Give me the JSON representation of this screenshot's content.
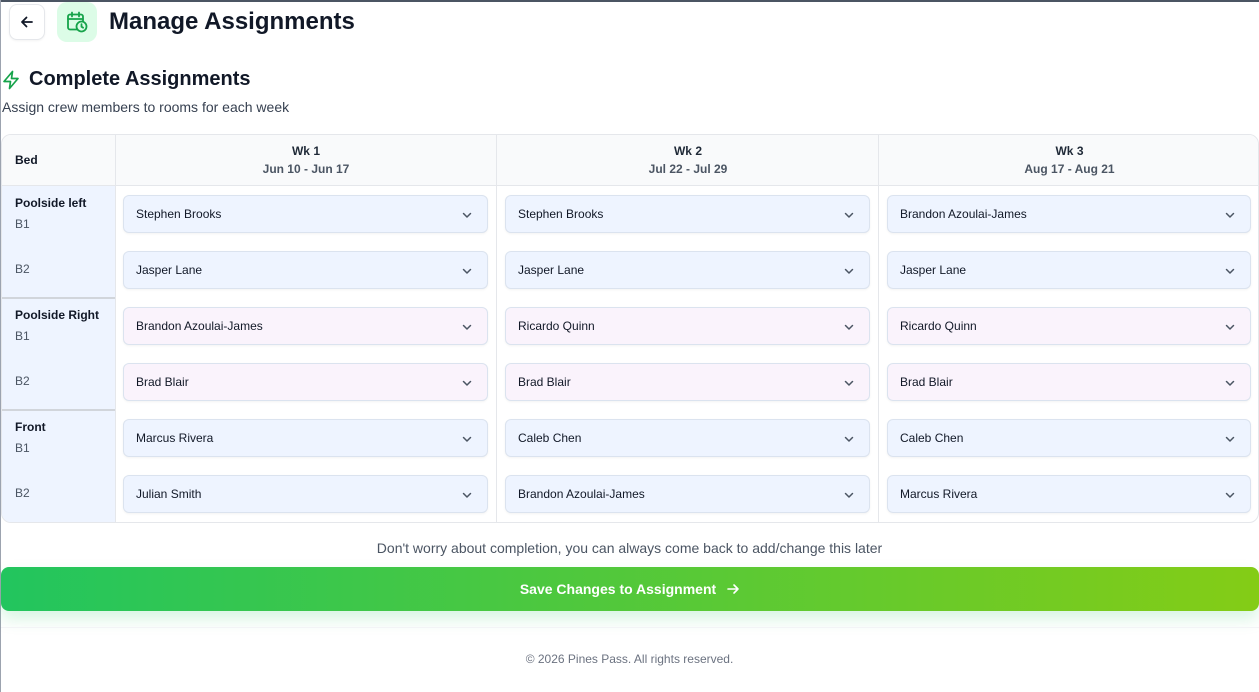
{
  "header": {
    "title": "Manage Assignments"
  },
  "section": {
    "title": "Complete Assignments",
    "subtitle": "Assign crew members to rooms for each week"
  },
  "table": {
    "bed_header": "Bed",
    "weeks": [
      {
        "label": "Wk 1",
        "dates": "Jun 10 - Jun 17"
      },
      {
        "label": "Wk 2",
        "dates": "Jul 22 - Jul 29"
      },
      {
        "label": "Wk 3",
        "dates": "Aug 17 - Aug 21"
      }
    ],
    "rooms": [
      {
        "name": "Poolside left",
        "tint": "blue",
        "beds": [
          {
            "code": "B1",
            "assignments": [
              "Stephen Brooks",
              "Stephen Brooks",
              "Brandon Azoulai-James"
            ]
          },
          {
            "code": "B2",
            "assignments": [
              "Jasper Lane",
              "Jasper Lane",
              "Jasper Lane"
            ]
          }
        ]
      },
      {
        "name": "Poolside Right",
        "tint": "pink",
        "beds": [
          {
            "code": "B1",
            "assignments": [
              "Brandon Azoulai-James",
              "Ricardo Quinn",
              "Ricardo Quinn"
            ]
          },
          {
            "code": "B2",
            "assignments": [
              "Brad Blair",
              "Brad Blair",
              "Brad Blair"
            ]
          }
        ]
      },
      {
        "name": "Front",
        "tint": "blue",
        "beds": [
          {
            "code": "B1",
            "assignments": [
              "Marcus Rivera",
              "Caleb Chen",
              "Caleb Chen"
            ]
          },
          {
            "code": "B2",
            "assignments": [
              "Julian Smith",
              "Brandon Azoulai-James",
              "Marcus Rivera"
            ]
          }
        ]
      }
    ]
  },
  "note": "Don't worry about completion, you can always come back to add/change this later",
  "save_button": {
    "label": "Save Changes to Assignment"
  },
  "footer": {
    "copyright": "© 2026 Pines Pass. All rights reserved."
  },
  "icons": {
    "back": "arrow-left-icon",
    "app": "calendar-clock-icon",
    "section": "lightning-icon",
    "dropdown": "chevron-down-icon",
    "save": "arrow-right-icon"
  },
  "colors": {
    "accent": "#16a34a",
    "button_start": "#22c55e",
    "button_end": "#84cc16"
  }
}
